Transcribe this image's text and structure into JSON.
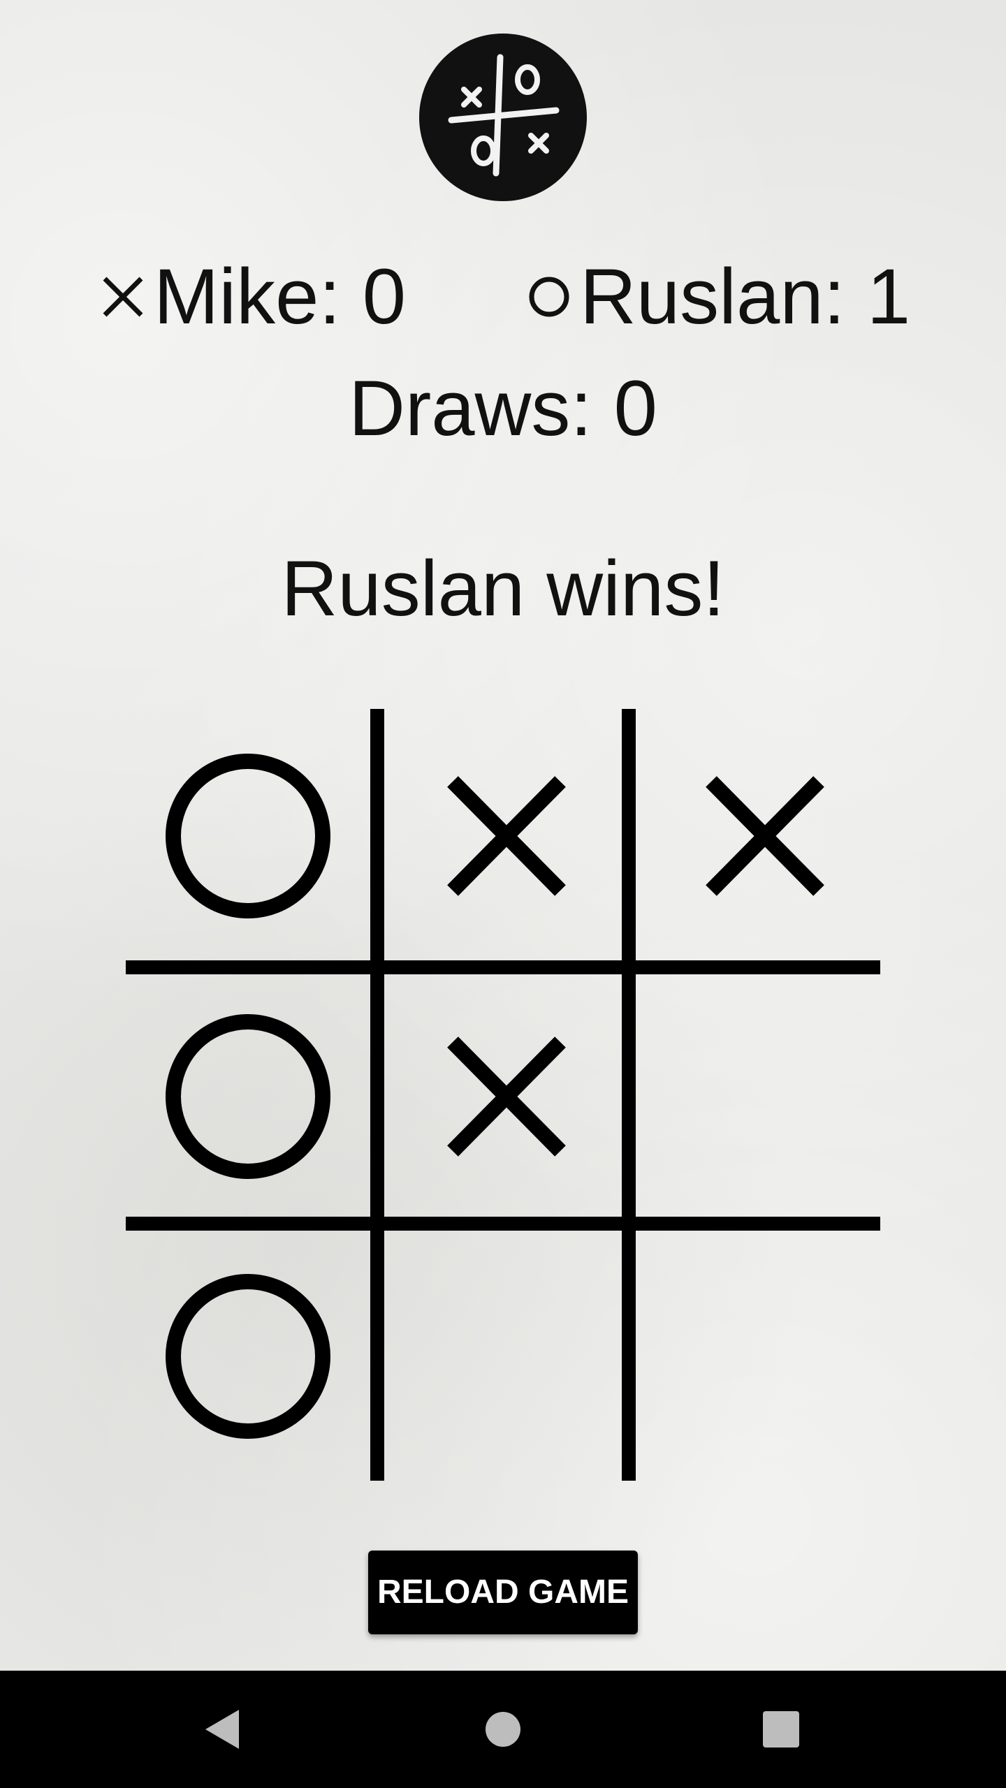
{
  "app": {
    "logo_icon": "tic-tac-toe-logo-icon"
  },
  "scoreboard": {
    "player_x": {
      "mark": "x-icon",
      "text": "Mike: 0",
      "name": "Mike",
      "score": 0
    },
    "player_o": {
      "mark": "o-icon",
      "text": "Ruslan: 1",
      "name": "Ruslan",
      "score": 1
    },
    "draws": {
      "text": "Draws: 0",
      "count": 0
    }
  },
  "status": "Ruslan wins!",
  "board": {
    "cells": [
      "O",
      "X",
      "X",
      "O",
      "X",
      "",
      "O",
      "",
      ""
    ]
  },
  "reload_button": {
    "label": "RELOAD GAME"
  },
  "navbar": {
    "back_icon": "back-triangle-icon",
    "home_icon": "home-circle-icon",
    "recents_icon": "recents-square-icon"
  },
  "colors": {
    "ink": "#111111",
    "button_bg": "#000000",
    "button_text": "#ffffff",
    "navbar_bg": "#000000",
    "navbar_icons": "#bdbdbd"
  }
}
